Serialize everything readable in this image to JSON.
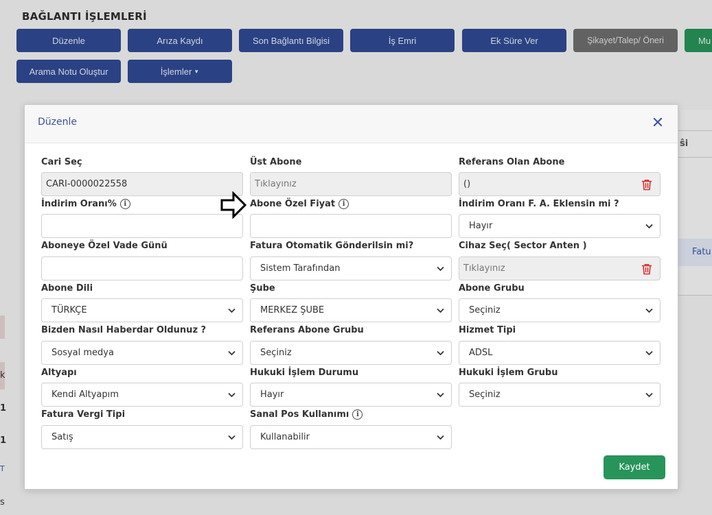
{
  "page": {
    "title": "BAĞLANTI İŞLEMLERİ",
    "buttons": [
      {
        "label": "Düzenle"
      },
      {
        "label": "Arıza Kaydı"
      },
      {
        "label": "Son Bağlantı Bilgisi"
      },
      {
        "label": "İş Emri"
      },
      {
        "label": "Ek Süre Ver"
      },
      {
        "label": "Şikayet/Talep/ Öneri"
      },
      {
        "label": "Mu"
      },
      {
        "label": "Arama Notu Oluştur"
      },
      {
        "label": "İşlemler"
      }
    ],
    "right_fragments": {
      "row1": "ŝi",
      "row2": "Fatu"
    },
    "left_fragments": [
      "k",
      "1",
      "1",
      "T",
      "s"
    ]
  },
  "modal": {
    "title": "Düzenle",
    "save_label": "Kaydet",
    "fields": {
      "cari_sec": {
        "label": "Cari Seç",
        "value": "CARI-0000022558"
      },
      "ust_abone": {
        "label": "Üst Abone",
        "placeholder": "Tıklayınız"
      },
      "referans_olan_abone": {
        "label": "Referans Olan Abone",
        "value": "()"
      },
      "indirim_orani": {
        "label": "İndirim Oranı%",
        "value": ""
      },
      "abone_ozel_fiyat": {
        "label": "Abone Özel Fiyat",
        "value": ""
      },
      "indirim_fa": {
        "label": "İndirim Oranı F. A. Eklensin mi ?",
        "value": "Hayır"
      },
      "vade_gunu": {
        "label": "Aboneye Özel Vade Günü",
        "value": ""
      },
      "fatura_otomatik": {
        "label": "Fatura Otomatik Gönderilsin mi?",
        "value": "Sistem Tarafından"
      },
      "cihaz_sec": {
        "label": "Cihaz Seç( Sector Anten )",
        "placeholder": "Tıklayınız"
      },
      "abone_dili": {
        "label": "Abone Dili",
        "value": "TÜRKÇE"
      },
      "sube": {
        "label": "Şube",
        "value": "MERKEZ ŞUBE"
      },
      "abone_grubu": {
        "label": "Abone Grubu",
        "value": "Seçiniz"
      },
      "haberdar": {
        "label": "Bizden Nasıl Haberdar Oldunuz ?",
        "value": "Sosyal medya"
      },
      "referans_abone_grubu": {
        "label": "Referans Abone Grubu",
        "value": "Seçiniz"
      },
      "hizmet_tipi": {
        "label": "Hizmet Tipi",
        "value": "ADSL"
      },
      "altyapi": {
        "label": "Altyapı",
        "value": "Kendi Altyapım"
      },
      "hukuki_durum": {
        "label": "Hukuki İşlem Durumu",
        "value": "Hayır"
      },
      "hukuki_grup": {
        "label": "Hukuki İşlem Grubu",
        "value": "Seçiniz"
      },
      "fatura_vergi": {
        "label": "Fatura Vergi Tipi",
        "value": "Satış"
      },
      "sanal_pos": {
        "label": "Sanal Pos Kullanımı",
        "value": "Kullanabilir"
      }
    }
  },
  "colors": {
    "primary": "#2f4a94",
    "success": "#27945a",
    "danger": "#d9302f",
    "secondary": "#6e6e6e"
  }
}
